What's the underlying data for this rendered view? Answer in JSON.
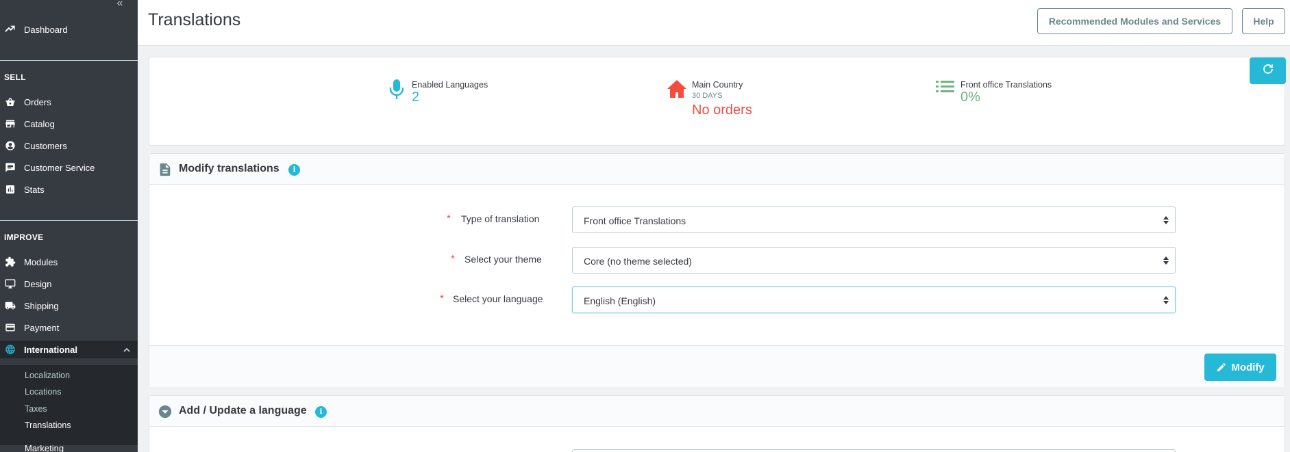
{
  "sidebar": {
    "collapse_icon": "double-chevron-left-icon",
    "dashboard": {
      "label": "Dashboard",
      "icon": "trending-up-icon"
    },
    "sections": [
      {
        "title": "SELL"
      },
      {
        "title": "IMPROVE"
      }
    ],
    "sell_items": [
      {
        "label": "Orders",
        "icon": "basket-icon"
      },
      {
        "label": "Catalog",
        "icon": "store-icon"
      },
      {
        "label": "Customers",
        "icon": "account-circle-icon"
      },
      {
        "label": "Customer Service",
        "icon": "chat-icon"
      },
      {
        "label": "Stats",
        "icon": "bar-chart-icon"
      }
    ],
    "improve_items": [
      {
        "label": "Modules",
        "icon": "puzzle-icon"
      },
      {
        "label": "Design",
        "icon": "desktop-icon"
      },
      {
        "label": "Shipping",
        "icon": "truck-icon"
      },
      {
        "label": "Payment",
        "icon": "credit-card-icon"
      },
      {
        "label": "International",
        "icon": "globe-icon"
      }
    ],
    "international_sub": [
      {
        "label": "Localization"
      },
      {
        "label": "Locations"
      },
      {
        "label": "Taxes"
      },
      {
        "label": "Translations"
      }
    ],
    "next_item_partial": "Marketing"
  },
  "header": {
    "title": "Translations",
    "recommended_label": "Recommended Modules and Services",
    "help_label": "Help"
  },
  "kpis": [
    {
      "title": "Enabled Languages",
      "subtitle": "",
      "value": "2",
      "color": "#25b9d7",
      "icon": "microphone-icon"
    },
    {
      "title": "Main Country",
      "subtitle": "30 DAYS",
      "value": "No orders",
      "color": "#f54c3e",
      "icon": "home-icon"
    },
    {
      "title": "Front office Translations",
      "subtitle": "",
      "value": "0%",
      "color": "#70b580",
      "icon": "list-icon"
    }
  ],
  "refresh_icon": "refresh-icon",
  "modify_panel": {
    "title": "Modify translations",
    "info_glyph": "i",
    "fields": [
      {
        "required": "*",
        "label": "Type of translation",
        "value": "Front office Translations"
      },
      {
        "required": "*",
        "label": "Select your theme",
        "value": "Core (no theme selected)"
      },
      {
        "required": "*",
        "label": "Select your language",
        "value": "English (English)"
      }
    ],
    "modify_label": "Modify"
  },
  "add_panel": {
    "title": "Add / Update a language",
    "info_glyph": "i"
  },
  "colors": {
    "accent": "#25b9d7",
    "sidebar_bg": "#363a41",
    "sidebar_active": "#25292e",
    "danger": "#f54c3e",
    "success": "#70b580"
  }
}
